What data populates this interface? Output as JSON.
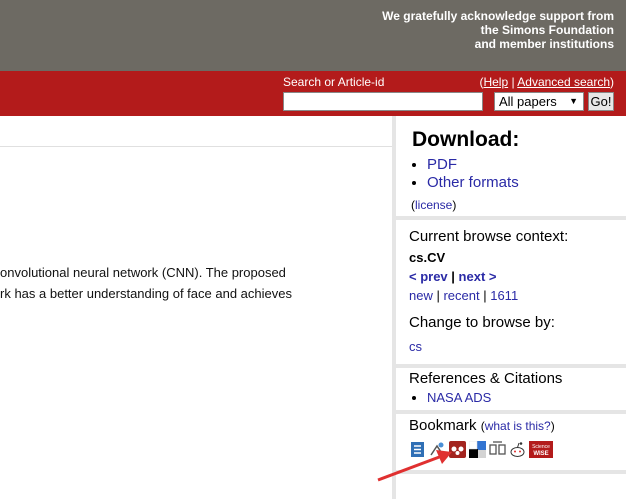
{
  "header": {
    "acknowledgement": [
      "We gratefully acknowledge support from",
      "the Simons Foundation",
      "and member institutions"
    ]
  },
  "search": {
    "label": "Search or Article-id",
    "help_open": "(",
    "help_label": "Help",
    "sep": " | ",
    "advanced_label": "Advanced search",
    "help_close": ")",
    "input_value": "",
    "select_value": "All papers",
    "go_label": "Go!"
  },
  "abstract": {
    "line1": "onvolutional neural network (CNN). The proposed",
    "line2": "rk has a better understanding of face and achieves"
  },
  "download": {
    "title": "Download:",
    "items": [
      "PDF",
      "Other formats"
    ],
    "license_open": "(",
    "license_label": "license",
    "license_close": ")"
  },
  "context": {
    "title": "Current browse context:",
    "category": "cs.CV",
    "prev_label": "< prev",
    "nav_sep": " | ",
    "next_label": "next >",
    "new_label": "new",
    "recent_label": "recent",
    "month_label": "1611",
    "link_sep": " | ",
    "change_title": "Change to browse by:",
    "change_link": "cs"
  },
  "refs": {
    "title": "References & Citations",
    "items": [
      "NASA ADS"
    ]
  },
  "bookmark": {
    "title": "Bookmark",
    "what_open": "(",
    "what_label": "what is this?",
    "what_close": ")",
    "icons": [
      "bibsonomy-icon",
      "citeulike-icon",
      "mendeley-icon",
      "delicious-icon",
      "digg-icon",
      "reddit-icon",
      "sciencewise-icon"
    ],
    "sciencewise_text": "Science WISE"
  },
  "colors": {
    "header_gray": "#6d6a63",
    "brand_red": "#b31b1b",
    "link_blue": "#2a2aa6",
    "annotation_red": "#e03030"
  }
}
